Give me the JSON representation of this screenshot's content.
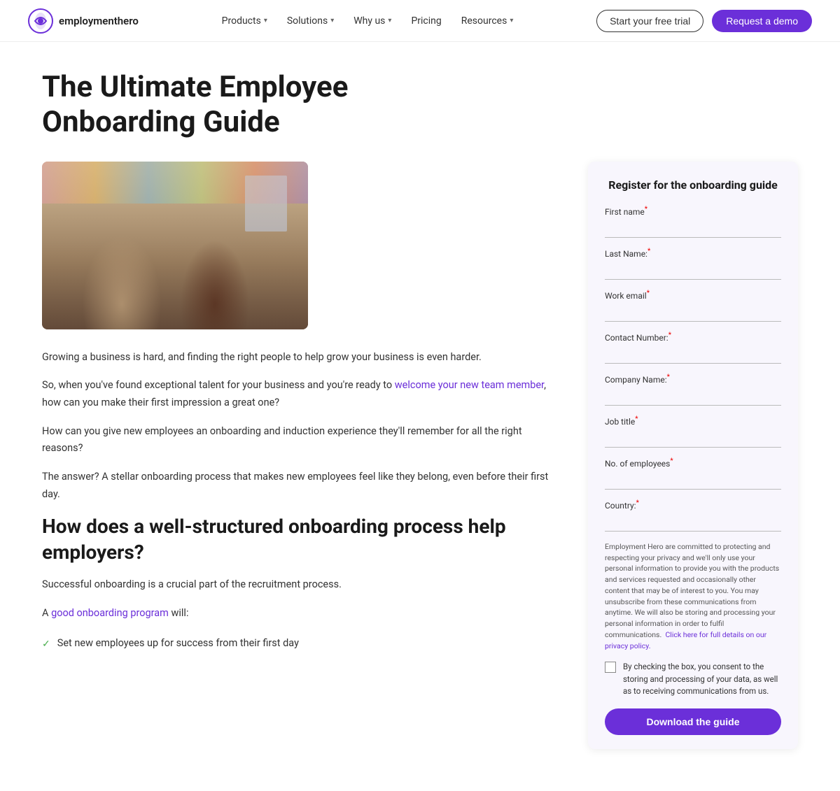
{
  "nav": {
    "logo_text": "employmenthero",
    "links": [
      {
        "label": "Products",
        "has_dropdown": true
      },
      {
        "label": "Solutions",
        "has_dropdown": true
      },
      {
        "label": "Why us",
        "has_dropdown": true
      },
      {
        "label": "Pricing",
        "has_dropdown": false
      },
      {
        "label": "Resources",
        "has_dropdown": true
      }
    ],
    "btn_trial": "Start your free trial",
    "btn_demo": "Request a demo"
  },
  "page": {
    "title": "The Ultimate Employee Onboarding Guide"
  },
  "article": {
    "para1": "Growing a business is hard, and finding the right people to help grow your business is even harder.",
    "para2_before": "So, when you've found exceptional talent for your business and you're ready to ",
    "para2_link_text": "welcome your new team member",
    "para2_after": ", how can you make their first impression a great one?",
    "para3": "How can you give new employees an onboarding and induction experience they'll remember for all the right reasons?",
    "para4": "The answer? A stellar onboarding process that makes new employees feel like they belong, even before their first day.",
    "section_heading": "How does a well-structured onboarding process help employers?",
    "para5": "Successful onboarding is a crucial part of the recruitment process.",
    "para6_before": "A ",
    "para6_link_text": "good onboarding program",
    "para6_after": " will:",
    "checklist": [
      "Set new employees up for success from their first day"
    ]
  },
  "form": {
    "title": "Register for the onboarding guide",
    "fields": [
      {
        "label": "First name",
        "required": true,
        "name": "first-name"
      },
      {
        "label": "Last Name:",
        "required": true,
        "name": "last-name"
      },
      {
        "label": "Work email",
        "required": true,
        "name": "work-email"
      },
      {
        "label": "Contact Number:",
        "required": true,
        "name": "contact-number"
      },
      {
        "label": "Company Name:",
        "required": true,
        "name": "company-name"
      },
      {
        "label": "Job title",
        "required": true,
        "name": "job-title"
      },
      {
        "label": "No. of employees",
        "required": true,
        "name": "num-employees"
      },
      {
        "label": "Country:",
        "required": true,
        "name": "country"
      }
    ],
    "privacy_text": "Employment Hero are committed to protecting and respecting your privacy and we'll only use your personal information to provide you with the products and services requested and occasionally other content that may be of interest to you. You may unsubscribe from these communications from anytime. We will also be storing and processing your personal information in order to fulfil communications.",
    "privacy_link_text": "Click here for full details on our privacy policy.",
    "consent_text": "By checking the box, you consent to the storing and processing of your data, as well as to receiving communications from us.",
    "download_btn": "Download the guide"
  },
  "colors": {
    "brand_purple": "#6B2FD9",
    "link_purple": "#6B2FD9",
    "check_green": "#4CAF50"
  }
}
